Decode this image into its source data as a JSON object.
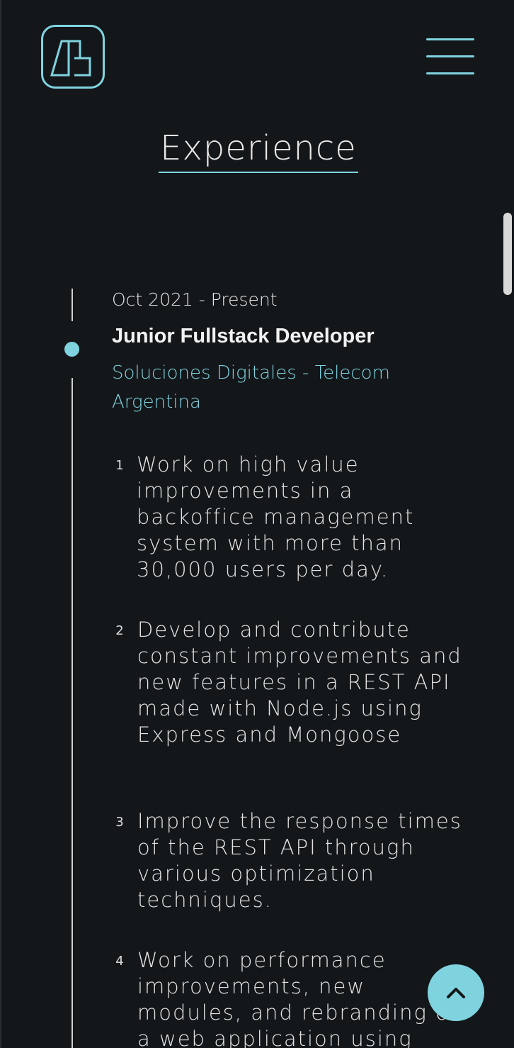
{
  "header": {
    "logo_icon": "monogram-logo",
    "menu_icon": "hamburger-menu-icon",
    "accent_color": "#7fd3df"
  },
  "section": {
    "title": "Experience"
  },
  "experience": {
    "date": "Oct 2021 - Present",
    "role": "Junior Fullstack Developer",
    "company": "Soluciones Digitales - Telecom Argentina",
    "items": [
      {
        "num": "1",
        "text": "Work on high value improvements in a backoffice management system with more than 30,000 users per day."
      },
      {
        "num": "2",
        "text": "Develop and contribute constant improvements and new features in a REST API made with Node.js using Express and Mongoose"
      },
      {
        "num": "3",
        "text": "Improve the response times of the REST API through various optimization techniques."
      },
      {
        "num": "4",
        "text": "Work on performance improvements, new modules, and rebranding of a web application using"
      }
    ]
  },
  "scroll_top": {
    "icon": "chevron-up-icon"
  }
}
